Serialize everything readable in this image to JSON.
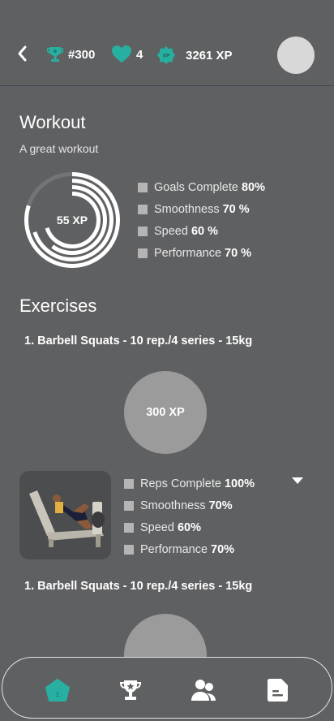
{
  "header": {
    "rank": "#300",
    "lives": "4",
    "xp_badge": "XP",
    "xp_total": "3261 XP"
  },
  "workout": {
    "title": "Workout",
    "subtitle": "A great workout",
    "ring_label": "55 XP",
    "metrics": [
      {
        "label": "Goals Complete",
        "value": "80%"
      },
      {
        "label": "Smoothness",
        "value": "70 %"
      },
      {
        "label": "Speed",
        "value": "60 %"
      },
      {
        "label": "Performance",
        "value": "70 %"
      }
    ]
  },
  "exercises": {
    "title": "Exercises",
    "items": [
      {
        "name": "1. Barbell Squats - 10 rep./4 series - 15kg",
        "xp": "300 XP",
        "metrics": [
          {
            "label": "Reps Complete",
            "value": "100%"
          },
          {
            "label": "Smoothness",
            "value": "70%"
          },
          {
            "label": "Speed",
            "value": "60%"
          },
          {
            "label": "Performance",
            "value": "70%"
          }
        ]
      },
      {
        "name": "1. Barbell Squats - 10 rep./4 series - 15kg"
      }
    ]
  },
  "nav": {
    "items": [
      "home-icon",
      "trophy-icon",
      "users-icon",
      "document-icon"
    ],
    "active": "home-icon",
    "home_badge": "1"
  },
  "colors": {
    "background": "#5f6062",
    "accent": "#27b0a1",
    "circle": "#9b9b9b"
  }
}
